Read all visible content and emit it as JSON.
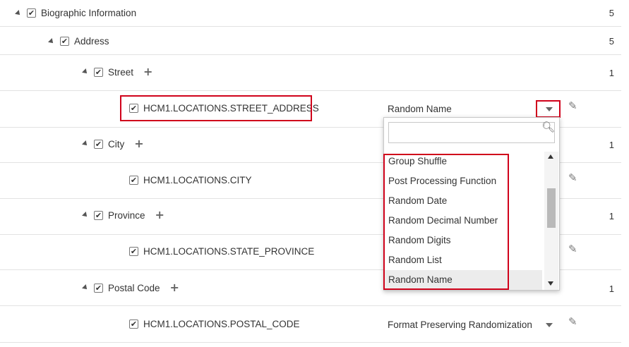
{
  "tree": {
    "biographic": {
      "label": "Biographic Information",
      "count": "5"
    },
    "address": {
      "label": "Address",
      "count": "5"
    },
    "street": {
      "label": "Street",
      "count": "1",
      "column": {
        "label": "HCM1.LOCATIONS.STREET_ADDRESS",
        "method": "Random Name"
      }
    },
    "city": {
      "label": "City",
      "count": "1",
      "column": {
        "label": "HCM1.LOCATIONS.CITY"
      }
    },
    "province": {
      "label": "Province",
      "count": "1",
      "column": {
        "label": "HCM1.LOCATIONS.STATE_PROVINCE"
      }
    },
    "postal": {
      "label": "Postal Code",
      "count": "1",
      "column": {
        "label": "HCM1.LOCATIONS.POSTAL_CODE",
        "method": "Format Preserving Randomization"
      }
    }
  },
  "dropdown": {
    "search_value": "",
    "options": [
      "Group Shuffle",
      "Post Processing Function",
      "Random Date",
      "Random Decimal Number",
      "Random Digits",
      "Random List",
      "Random Name"
    ],
    "selected": "Random Name"
  },
  "icons": {
    "check": "checkmark-icon",
    "add": "plus-icon",
    "edit": "pencil-icon",
    "search": "search-icon"
  },
  "colors": {
    "highlight": "#d0021b",
    "row_border": "#e2e2e2",
    "selected_bg": "#ececec"
  }
}
